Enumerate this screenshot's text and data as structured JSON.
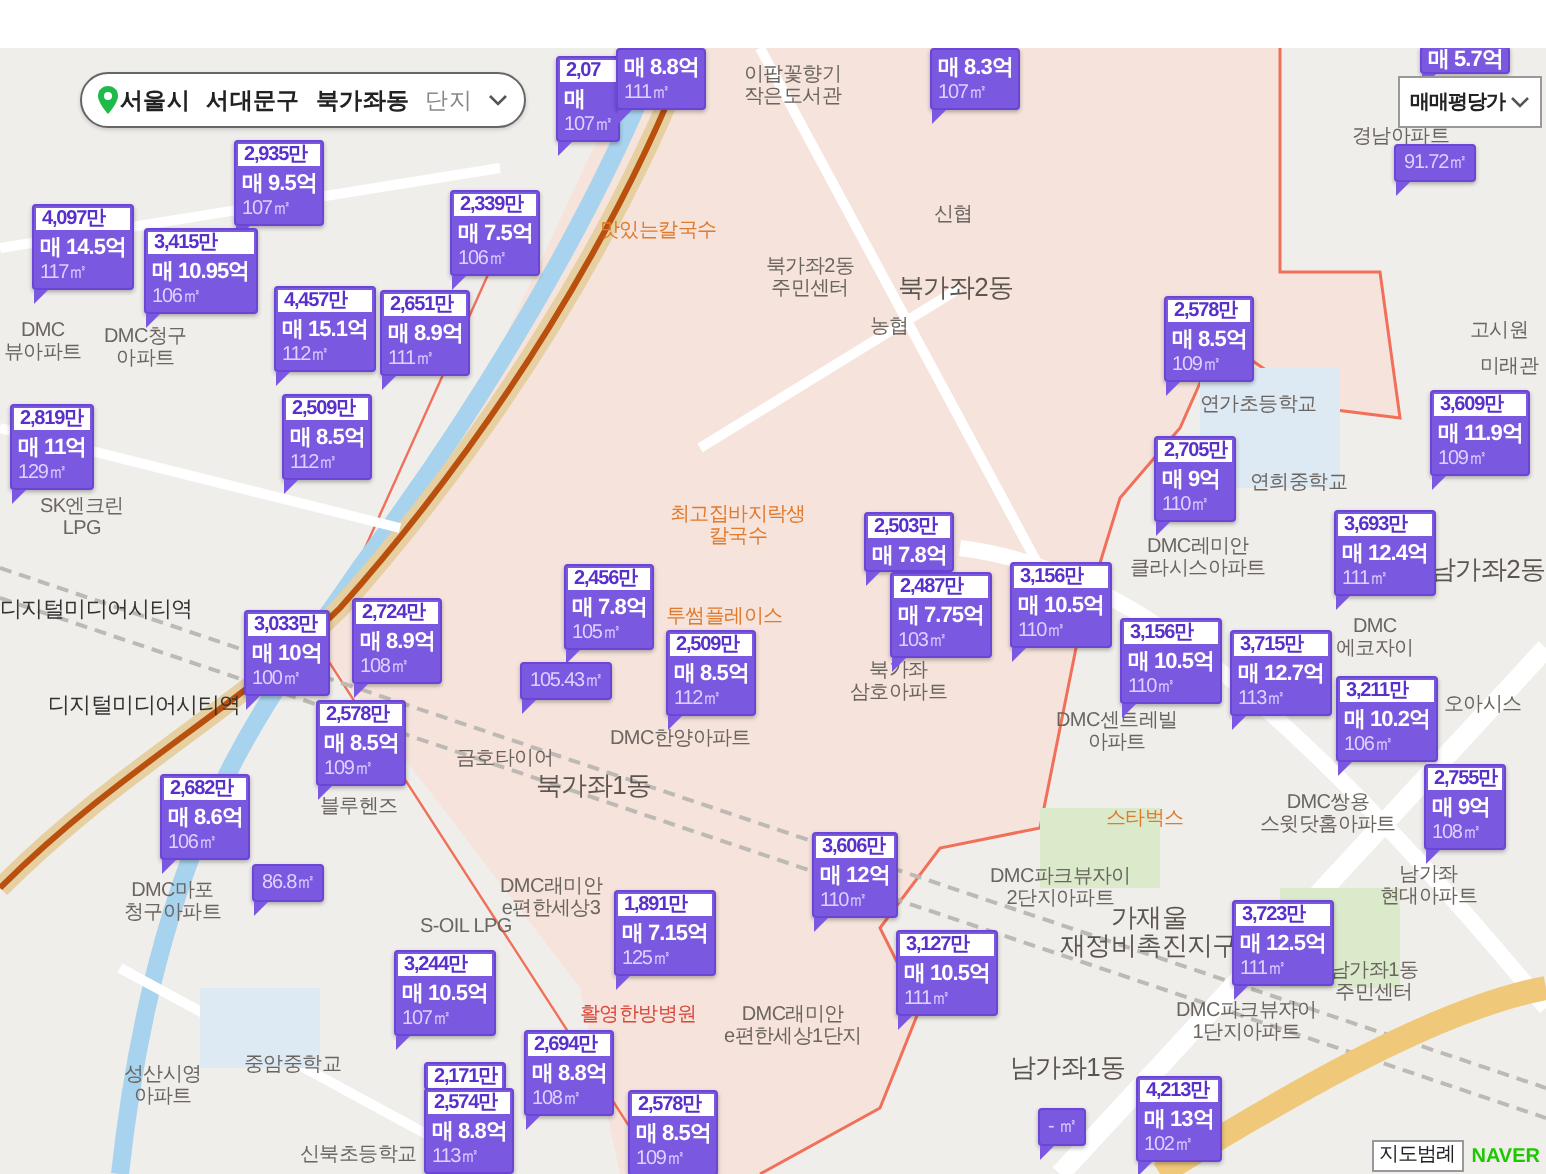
{
  "breadcrumb": {
    "items": [
      {
        "label": "서울시",
        "kind": "region"
      },
      {
        "label": "서대문구",
        "kind": "region"
      },
      {
        "label": "북가좌동",
        "kind": "region"
      },
      {
        "label": "단지",
        "kind": "filter"
      }
    ]
  },
  "price_type_dropdown": {
    "label": "매매평당가"
  },
  "map_labels": [
    {
      "text": "이팝꽃향기\n작은도서관",
      "kind": "place"
    },
    {
      "text": "경남아파트",
      "kind": "place"
    },
    {
      "text": "신협",
      "kind": "place"
    },
    {
      "text": "맛있는칼국수",
      "kind": "poi"
    },
    {
      "text": "북가좌2동\n주민센터",
      "kind": "place"
    },
    {
      "text": "북가좌2동",
      "kind": "district"
    },
    {
      "text": "DMC\n뷰아파트",
      "kind": "place"
    },
    {
      "text": "DMC청구\n아파트",
      "kind": "place"
    },
    {
      "text": "농협",
      "kind": "place"
    },
    {
      "text": "고시원",
      "kind": "place"
    },
    {
      "text": "미래관",
      "kind": "place"
    },
    {
      "text": "연가초등학교",
      "kind": "place"
    },
    {
      "text": "연희중학교",
      "kind": "place"
    },
    {
      "text": "SK엔크린\nLPG",
      "kind": "place"
    },
    {
      "text": "최고집바지락생\n칼국수",
      "kind": "poi"
    },
    {
      "text": "DMC레미안\n클라시스아파트",
      "kind": "place"
    },
    {
      "text": "남가좌2동",
      "kind": "district"
    },
    {
      "text": "디지털미디어시티역",
      "kind": "station"
    },
    {
      "text": "투썸플레이스",
      "kind": "poi"
    },
    {
      "text": "DMC\n에코자이",
      "kind": "place"
    },
    {
      "text": "북가좌\n삼호아파트",
      "kind": "place"
    },
    {
      "text": "디지털미디어시티역",
      "kind": "station"
    },
    {
      "text": "DMC센트레빌\n아파트",
      "kind": "place"
    },
    {
      "text": "오아시스",
      "kind": "place"
    },
    {
      "text": "DMC한양아파트",
      "kind": "place"
    },
    {
      "text": "금호타이어",
      "kind": "place"
    },
    {
      "text": "북가좌1동",
      "kind": "district"
    },
    {
      "text": "블루헨즈",
      "kind": "place"
    },
    {
      "text": "스타벅스",
      "kind": "poi"
    },
    {
      "text": "DMC쌍용\n스윗닷홈아파트",
      "kind": "place"
    },
    {
      "text": "DMC파크뷰자이\n2단지아파트",
      "kind": "place"
    },
    {
      "text": "남가좌\n현대아파트",
      "kind": "place"
    },
    {
      "text": "DMC마포\n청구아파트",
      "kind": "place"
    },
    {
      "text": "DMC래미안\ne편한세상3",
      "kind": "place"
    },
    {
      "text": "S-OIL LPG",
      "kind": "place"
    },
    {
      "text": "가재울\n재정비촉진지구",
      "kind": "district"
    },
    {
      "text": "남가좌1동\n주민센터",
      "kind": "place"
    },
    {
      "text": "활영한방병원",
      "kind": "hospital"
    },
    {
      "text": "DMC래미안\ne편한세상1단지",
      "kind": "place"
    },
    {
      "text": "DMC파크뷰자이\n1단지아파트",
      "kind": "place"
    },
    {
      "text": "성산시영\n아파트",
      "kind": "place"
    },
    {
      "text": "중암중학교",
      "kind": "place"
    },
    {
      "text": "남가좌1동",
      "kind": "district"
    },
    {
      "text": "신북초등학교",
      "kind": "place"
    }
  ],
  "markers": [
    {
      "price_per_area": "2,07",
      "price": "매",
      "area": "107㎡"
    },
    {
      "price": "매 8.8억",
      "area": "111㎡"
    },
    {
      "price": "매 8.3억",
      "area": "107㎡"
    },
    {
      "price": "매 5.7억"
    },
    {
      "price_per_area": "2,935만",
      "price": "매 9.5억",
      "area": "107㎡"
    },
    {
      "area": "91.72㎡"
    },
    {
      "price_per_area": "4,097만",
      "price": "매 14.5억",
      "area": "117㎡"
    },
    {
      "price_per_area": "2,339만",
      "price": "매 7.5억",
      "area": "106㎡"
    },
    {
      "price_per_area": "3,415만",
      "price": "매 10.95억",
      "area": "106㎡"
    },
    {
      "price_per_area": "4,457만",
      "price": "매 15.1억",
      "area": "112㎡"
    },
    {
      "price_per_area": "2,651만",
      "price": "매 8.9억",
      "area": "111㎡"
    },
    {
      "price_per_area": "2,578만",
      "price": "매 8.5억",
      "area": "109㎡"
    },
    {
      "price_per_area": "2,819만",
      "price": "매 11억",
      "area": "129㎡"
    },
    {
      "price_per_area": "2,509만",
      "price": "매 8.5억",
      "area": "112㎡"
    },
    {
      "price_per_area": "3,609만",
      "price": "매 11.9억",
      "area": "109㎡"
    },
    {
      "price_per_area": "2,705만",
      "price": "매 9억",
      "area": "110㎡"
    },
    {
      "price_per_area": "2,503만",
      "price": "매 7.8억"
    },
    {
      "price_per_area": "3,693만",
      "price": "매 12.4억",
      "area": "111㎡"
    },
    {
      "price_per_area": "2,456만",
      "price": "매 7.8억",
      "area": "105㎡"
    },
    {
      "price_per_area": "2,487만",
      "price": "매 7.75억",
      "area": "103㎡"
    },
    {
      "price_per_area": "3,156만",
      "price": "매 10.5억",
      "area": "110㎡"
    },
    {
      "price_per_area": "3,033만",
      "price": "매 10억",
      "area": "100㎡"
    },
    {
      "price_per_area": "2,724만",
      "price": "매 8.9억",
      "area": "108㎡"
    },
    {
      "price_per_area": "2,509만",
      "price": "매 8.5억",
      "area": "112㎡"
    },
    {
      "price_per_area": "3,156만",
      "price": "매 10.5억",
      "area": "110㎡"
    },
    {
      "price_per_area": "3,715만",
      "price": "매 12.7억",
      "area": "113㎡"
    },
    {
      "area": "105.43㎡"
    },
    {
      "price_per_area": "3,211만",
      "price": "매 10.2억",
      "area": "106㎡"
    },
    {
      "price_per_area": "2,578만",
      "price": "매 8.5억",
      "area": "109㎡"
    },
    {
      "price_per_area": "2,682만",
      "price": "매 8.6억",
      "area": "106㎡"
    },
    {
      "price_per_area": "2,755만",
      "price": "매 9억",
      "area": "108㎡"
    },
    {
      "price_per_area": "3,606만",
      "price": "매 12억",
      "area": "110㎡"
    },
    {
      "area": "86.8㎡"
    },
    {
      "price_per_area": "1,891만",
      "price": "매 7.15억",
      "area": "125㎡"
    },
    {
      "price_per_area": "3,723만",
      "price": "매 12.5억",
      "area": "111㎡"
    },
    {
      "price_per_area": "3,244만",
      "price": "매 10.5억",
      "area": "107㎡"
    },
    {
      "price_per_area": "3,127만",
      "price": "매 10.5억",
      "area": "111㎡"
    },
    {
      "price_per_area": "2,171만"
    },
    {
      "price_per_area": "2,694만",
      "price": "매 8.8억",
      "area": "108㎡"
    },
    {
      "price_per_area": "2,574만",
      "price": "매 8.8억",
      "area": "113㎡"
    },
    {
      "price_per_area": "2,578만",
      "price": "매 8.5억",
      "area": "109㎡"
    },
    {
      "price_per_area": "4,213만",
      "price": "매 13억",
      "area": "102㎡"
    },
    {
      "area": "- ㎡"
    }
  ],
  "map_legend_button": {
    "label": "지도범례"
  },
  "logo": {
    "label": "NAVER"
  }
}
